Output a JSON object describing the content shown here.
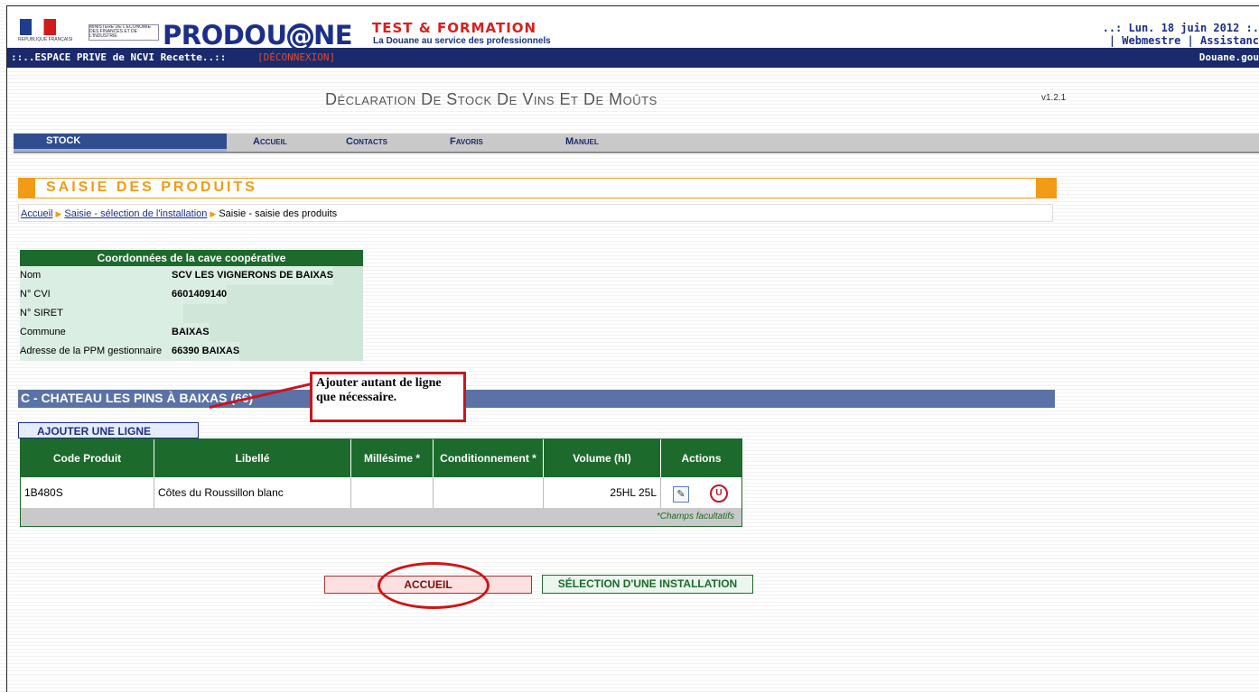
{
  "header": {
    "logo_text": "PRODOU",
    "logo_at": "@",
    "logo_end": "NE",
    "logo_tagline_1": "TEST & FORMATION",
    "logo_tagline_2": "La Douane au service des professionnels",
    "date_text": "..: Lun. 18 juin 2012 :.",
    "links_text": "| Webmestre | Assistanc",
    "ministry_text": "MINISTÈRE DE L'ÉCONOMIE DES FINANCES ET DE L'INDUSTRIE",
    "republique_text": "RÉPUBLIQUE FRANÇAISE"
  },
  "bluebar": {
    "espace": "::..ESPACE PRIVE de NCVI Recette..::",
    "deconnexion": "[DÉCONNEXION]",
    "douane": "Douane.gou"
  },
  "page": {
    "title": "Déclaration De Stock De Vins Et De Moûts",
    "version": "v1.2.1"
  },
  "menu": {
    "stock": "STOCK",
    "accueil": "Accueil",
    "contacts": "Contacts",
    "favoris": "Favoris",
    "manuel": "Manuel"
  },
  "saisie": {
    "title": "SAISIE DES PRODUITS",
    "crumb1": "Accueil",
    "crumb2": "Saisie - sélection de l'installation",
    "crumb3": "Saisie - saisie des produits"
  },
  "coop": {
    "header": "Coordonnées de la cave coopérative",
    "rows": [
      {
        "label": "Nom",
        "value": "SCV LES VIGNERONS DE BAIXAS"
      },
      {
        "label": "N° CVI",
        "value": "6601409140"
      },
      {
        "label": "N° SIRET",
        "value": ""
      },
      {
        "label": "Commune",
        "value": "BAIXAS"
      },
      {
        "label": "Adresse de la PPM gestionnaire",
        "value": "66390 BAIXAS"
      }
    ]
  },
  "section": {
    "title": "C - CHATEAU LES PINS À BAIXAS (66)",
    "add_line": "AJOUTER UNE LIGNE"
  },
  "callout": {
    "text": "Ajouter autant de ligne que nécessaire."
  },
  "products": {
    "headers": [
      "Code Produit",
      "Libellé",
      "Millésime *",
      "Conditionnement *",
      "Volume (hl)",
      "Actions"
    ],
    "rows": [
      {
        "code": "1B480S",
        "libelle": "Côtes du Roussillon blanc",
        "millesime": "",
        "conditionnement": "",
        "volume": "25HL 25L"
      }
    ],
    "footnote": "*Champs facultatifs"
  },
  "buttons": {
    "accueil": "ACCUEIL",
    "selection": "SÉLECTION D'UNE INSTALLATION"
  }
}
